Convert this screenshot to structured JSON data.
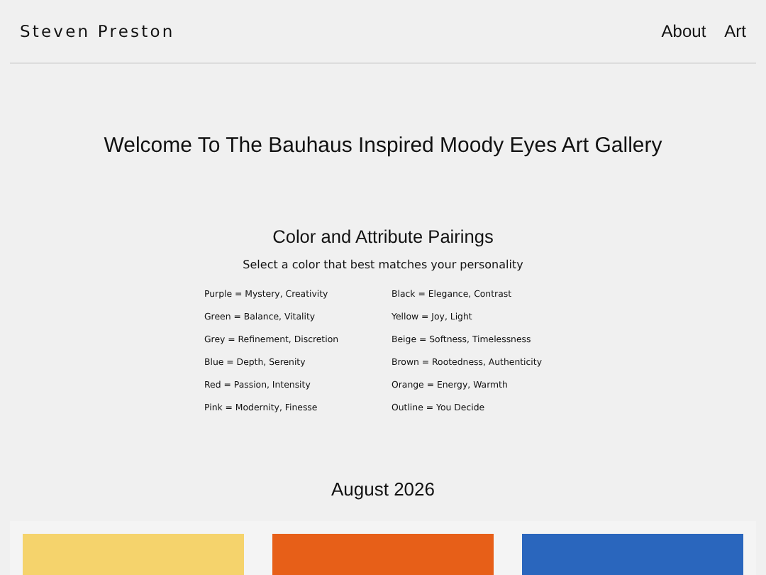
{
  "header": {
    "brand": "Steven Preston",
    "nav": [
      "About",
      "Art"
    ]
  },
  "welcome": "Welcome To The Bauhaus Inspired Moody Eyes Art Gallery",
  "pairings": {
    "title": "Color and Attribute Pairings",
    "subtitle": "Select a color that best matches your personality",
    "columns": [
      [
        "Purple = Mystery, Creativity",
        "Green = Balance, Vitality",
        "Grey = Refinement, Discretion",
        "Blue = Depth, Serenity",
        "Red = Passion, Intensity",
        "Pink = Modernity, Finesse"
      ],
      [
        "Black = Elegance, Contrast",
        "Yellow = Joy, Light",
        "Beige = Softness, Timelessness",
        "Brown = Rootedness, Authenticity",
        "Orange = Energy, Warmth",
        "Outline = You Decide"
      ]
    ]
  },
  "month": "August 2026",
  "artworks": [
    {
      "color": "#f5d36c"
    },
    {
      "color": "#e75f18"
    },
    {
      "color": "#2a66bd"
    }
  ]
}
